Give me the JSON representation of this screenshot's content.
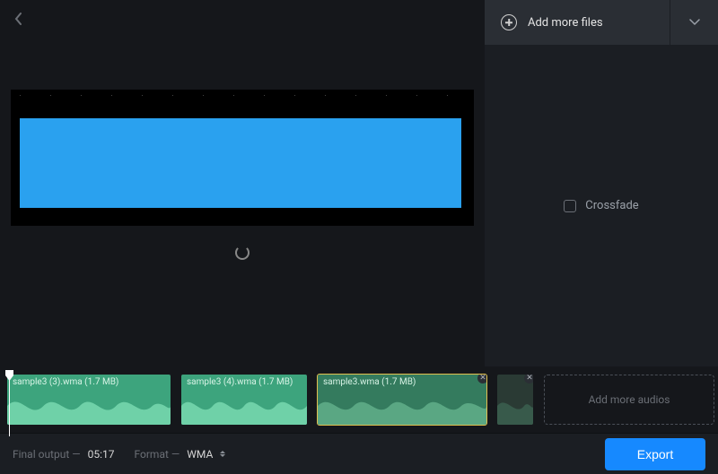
{
  "sidebar": {
    "add_files_label": "Add more files",
    "crossfade_label": "Crossfade"
  },
  "timeline": {
    "add_more_label": "Add more audios",
    "clips": [
      {
        "label": "sample3 (3).wma (1.7 MB)"
      },
      {
        "label": "sample3 (4).wma (1.7 MB)"
      },
      {
        "label": "sample3.wma (1.7 MB)"
      }
    ]
  },
  "footer": {
    "final_output_caption": "Final output —",
    "final_output_value": "05:17",
    "format_caption": "Format —",
    "format_value": "WMA",
    "export_label": "Export"
  }
}
